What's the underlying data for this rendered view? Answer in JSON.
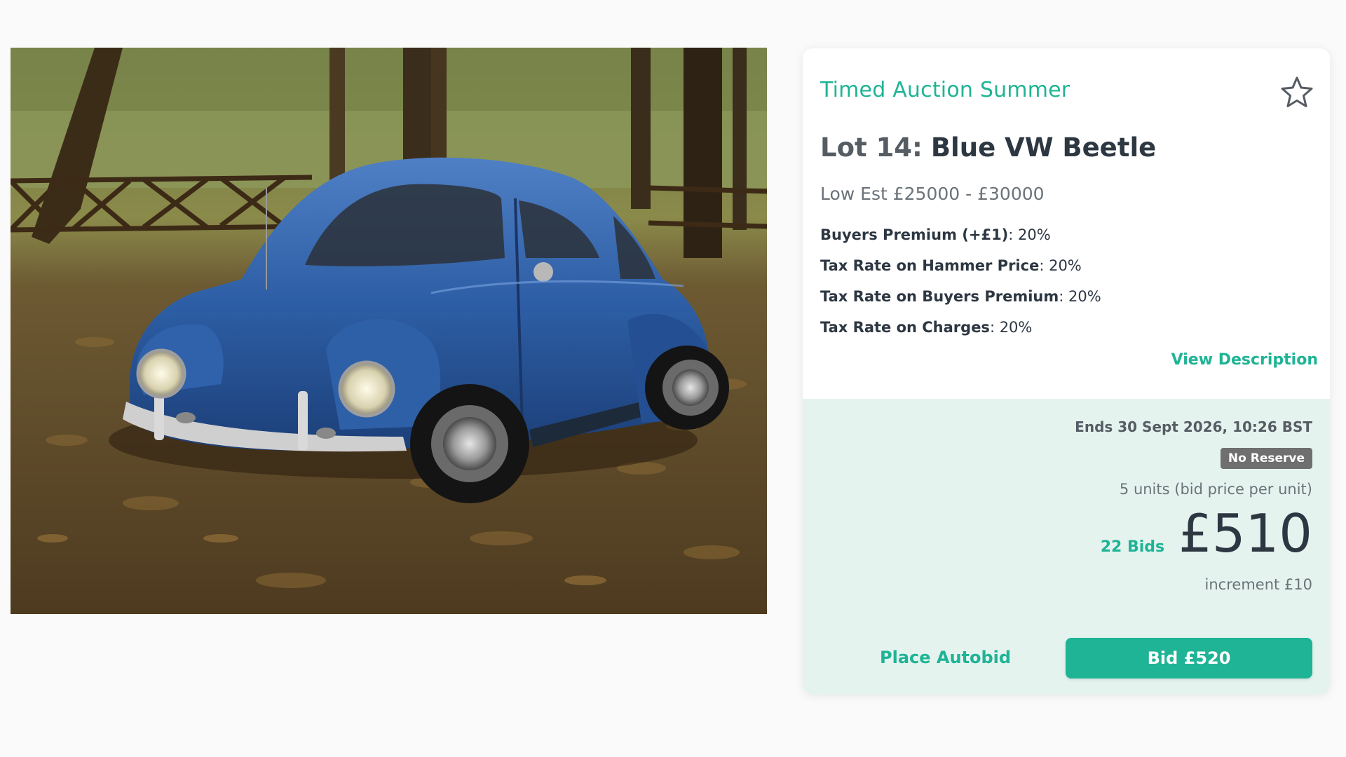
{
  "photo": {
    "alt": "Blue VW Beetle parked on autumn leaves"
  },
  "card": {
    "auction_name": "Timed Auction Summer",
    "favourite_icon": "star-outline-icon",
    "lot_number": "Lot 14:",
    "lot_title": "Blue VW Beetle",
    "estimate": "Low Est £25000 - £30000",
    "rates": [
      {
        "label": "Buyers Premium (+£1)",
        "value": ": 20%"
      },
      {
        "label": "Tax Rate on Hammer Price",
        "value": ": 20%"
      },
      {
        "label": "Tax Rate on Buyers Premium",
        "value": ": 20%"
      },
      {
        "label": "Tax Rate on Charges",
        "value": ": 20%"
      }
    ],
    "view_description": "View Description"
  },
  "bidding": {
    "ends": "Ends 30 Sept 2026, 10:26 BST",
    "reserve_badge": "No Reserve",
    "units": "5 units (bid price per unit)",
    "bids_count": "22 Bids",
    "current_price": "£510",
    "increment": "increment £10",
    "autobid_label": "Place Autobid",
    "bid_label": "Bid £520"
  },
  "colors": {
    "accent": "#1eb495",
    "panel_background": "#e5f3ef",
    "badge": "#6f6f6f",
    "text_dark": "#2d3742"
  }
}
